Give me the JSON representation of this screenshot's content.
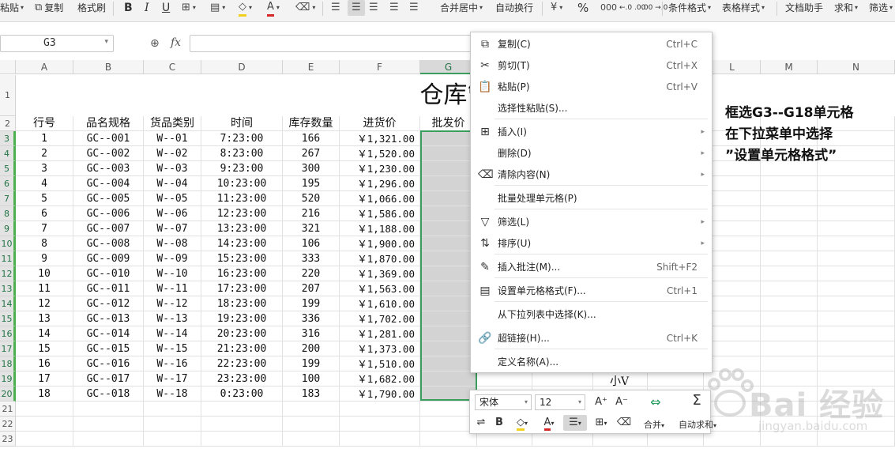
{
  "toolbar": {
    "paste": "粘贴",
    "copy": "复制",
    "format_painter": "格式刷",
    "bold": "B",
    "italic": "I",
    "underline": "U",
    "merge_center": "合并居中",
    "wrap_text": "自动换行",
    "percent": "%",
    "inc_decimal": "←.0 .00",
    "dec_decimal": ".00 →.0",
    "conditional_format": "条件格式",
    "table_style": "表格样式",
    "doc_assistant": "文档助手",
    "sum": "求和",
    "filter": "筛选"
  },
  "formula_bar": {
    "name_box": "G3",
    "fx_label": "fx",
    "formula": ""
  },
  "columns": [
    "A",
    "B",
    "C",
    "D",
    "E",
    "F",
    "G",
    "H",
    "I",
    "J",
    "K",
    "L",
    "M",
    "N"
  ],
  "selected_column": "G",
  "rows": [
    "1",
    "2",
    "3",
    "4",
    "5",
    "6",
    "7",
    "8",
    "9",
    "10",
    "11",
    "12",
    "13",
    "14",
    "15",
    "16",
    "17",
    "18",
    "19",
    "20",
    "21",
    "22",
    "23"
  ],
  "sheet": {
    "title": "仓库管",
    "headers": [
      "行号",
      "品名规格",
      "货品类别",
      "时间",
      "库存数量",
      "进货价",
      "批发价"
    ],
    "data": [
      [
        "1",
        "GC--001",
        "W--01",
        "7:23:00",
        "166",
        "￥1,321.00"
      ],
      [
        "2",
        "GC--002",
        "W--02",
        "8:23:00",
        "267",
        "￥1,520.00"
      ],
      [
        "3",
        "GC--003",
        "W--03",
        "9:23:00",
        "300",
        "￥1,230.00"
      ],
      [
        "4",
        "GC--004",
        "W--04",
        "10:23:00",
        "195",
        "￥1,296.00"
      ],
      [
        "5",
        "GC--005",
        "W--05",
        "11:23:00",
        "520",
        "￥1,066.00"
      ],
      [
        "6",
        "GC--006",
        "W--06",
        "12:23:00",
        "216",
        "￥1,586.00"
      ],
      [
        "7",
        "GC--007",
        "W--07",
        "13:23:00",
        "321",
        "￥1,188.00"
      ],
      [
        "8",
        "GC--008",
        "W--08",
        "14:23:00",
        "106",
        "￥1,900.00"
      ],
      [
        "9",
        "GC--009",
        "W--09",
        "15:23:00",
        "333",
        "￥1,870.00"
      ],
      [
        "10",
        "GC--010",
        "W--10",
        "16:23:00",
        "220",
        "￥1,369.00"
      ],
      [
        "11",
        "GC--011",
        "W--11",
        "17:23:00",
        "207",
        "￥1,563.00"
      ],
      [
        "12",
        "GC--012",
        "W--12",
        "18:23:00",
        "199",
        "￥1,610.00"
      ],
      [
        "13",
        "GC--013",
        "W--13",
        "19:23:00",
        "336",
        "￥1,702.00"
      ],
      [
        "14",
        "GC--014",
        "W--14",
        "20:23:00",
        "316",
        "￥1,281.00"
      ],
      [
        "15",
        "GC--015",
        "W--15",
        "21:23:00",
        "200",
        "￥1,373.00"
      ],
      [
        "16",
        "GC--016",
        "W--16",
        "22:23:00",
        "199",
        "￥1,510.00"
      ],
      [
        "17",
        "GC--017",
        "W--17",
        "23:23:00",
        "100",
        "￥1,682.00"
      ],
      [
        "18",
        "GC--018",
        "W--18",
        "0:23:00",
        "183",
        "￥1,790.00"
      ]
    ],
    "stray_text": "小V"
  },
  "annotation": "框选G3--G18单元格\n在下拉菜单中选择\n”设置单元格格式”",
  "context_menu": {
    "items": [
      {
        "name": "menu-copy",
        "icon": "copy-icon",
        "glyph": "⧉",
        "label": "复制(C)",
        "shortcut": "Ctrl+C",
        "submenu": false
      },
      {
        "name": "menu-cut",
        "icon": "scissors-icon",
        "glyph": "✂",
        "label": "剪切(T)",
        "shortcut": "Ctrl+X",
        "submenu": false
      },
      {
        "name": "menu-paste",
        "icon": "clipboard-icon",
        "glyph": "📋",
        "label": "粘贴(P)",
        "shortcut": "Ctrl+V",
        "submenu": false
      },
      {
        "name": "menu-paste-special",
        "icon": "",
        "glyph": "",
        "label": "选择性粘贴(S)...",
        "shortcut": "",
        "submenu": false
      },
      {
        "name": "menu-insert",
        "icon": "insert-cells-icon",
        "glyph": "⊞",
        "label": "插入(I)",
        "shortcut": "",
        "submenu": true
      },
      {
        "name": "menu-delete",
        "icon": "",
        "glyph": "",
        "label": "删除(D)",
        "shortcut": "",
        "submenu": true
      },
      {
        "name": "menu-clear",
        "icon": "eraser-icon",
        "glyph": "⌫",
        "label": "清除内容(N)",
        "shortcut": "",
        "submenu": true
      },
      {
        "name": "menu-batch",
        "icon": "",
        "glyph": "",
        "label": "批量处理单元格(P)",
        "shortcut": "",
        "submenu": false
      },
      {
        "name": "menu-filter",
        "icon": "funnel-icon",
        "glyph": "▽",
        "label": "筛选(L)",
        "shortcut": "",
        "submenu": true
      },
      {
        "name": "menu-sort",
        "icon": "sort-az-icon",
        "glyph": "⇅",
        "label": "排序(U)",
        "shortcut": "",
        "submenu": true
      },
      {
        "name": "menu-insert-comment",
        "icon": "comment-icon",
        "glyph": "✎",
        "label": "插入批注(M)...",
        "shortcut": "Shift+F2",
        "submenu": false
      },
      {
        "name": "menu-format-cells",
        "icon": "format-cells-icon",
        "glyph": "▤",
        "label": "设置单元格格式(F)...",
        "shortcut": "Ctrl+1",
        "submenu": false
      },
      {
        "name": "menu-pick-from-list",
        "icon": "",
        "glyph": "",
        "label": "从下拉列表中选择(K)...",
        "shortcut": "",
        "submenu": false
      },
      {
        "name": "menu-hyperlink",
        "icon": "link-icon",
        "glyph": "🔗",
        "label": "超链接(H)...",
        "shortcut": "Ctrl+K",
        "submenu": false
      },
      {
        "name": "menu-define-name",
        "icon": "",
        "glyph": "",
        "label": "定义名称(A)...",
        "shortcut": "",
        "submenu": false
      }
    ]
  },
  "mini_toolbar": {
    "font": "宋体",
    "size": "12",
    "grow": "A⁺",
    "shrink": "A⁻",
    "merge_label": "合并",
    "autosum_label": "自动求和",
    "bold": "B"
  },
  "watermark": {
    "text": "Bai 经验",
    "sub": "jingyan.baidu.com"
  }
}
